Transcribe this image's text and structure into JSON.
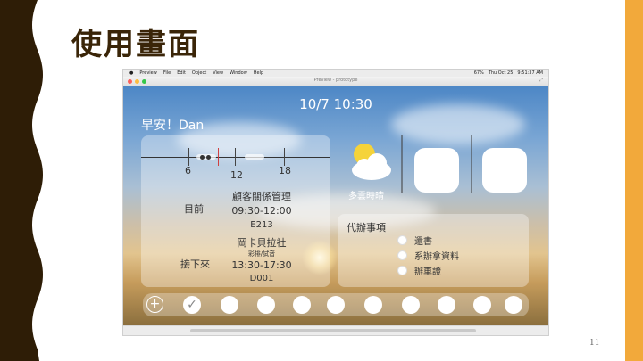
{
  "slide": {
    "title": "使用畫面",
    "page_number": "11",
    "colors": {
      "left_band": "#2e1d06",
      "right_band": "#f2a93b",
      "title": "#3a2508"
    }
  },
  "os": {
    "menubar_items": [
      "Preview",
      "File",
      "Edit",
      "Object",
      "View",
      "Window",
      "Help"
    ],
    "status": [
      "67%",
      "Thu Oct 25",
      "9:51:37 AM"
    ],
    "window_title": "Preview - prototype"
  },
  "app": {
    "datetime": "10/7  10:30",
    "greeting": "早安！Dan",
    "timeline": {
      "ticks": [
        "6",
        "12",
        "18"
      ]
    },
    "current": {
      "label": "目前",
      "course": "顧客關係管理",
      "time": "09:30-12:00",
      "room": "E213"
    },
    "next": {
      "label": "接下來",
      "course": "岡卡貝拉社",
      "subtitle": "彩排/試音",
      "time": "13:30-17:30",
      "room": "D001"
    },
    "weather": {
      "icon": "partly-cloudy-icon",
      "text": "多雲時晴"
    },
    "todo": {
      "title": "代辦事項",
      "items": [
        "還書",
        "系辦拿資料",
        "辦車證"
      ]
    },
    "dock": {
      "add": "+",
      "check": "✓"
    }
  }
}
